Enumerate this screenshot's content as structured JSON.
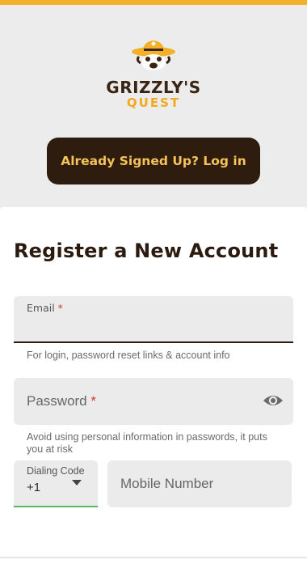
{
  "brand": {
    "name_line1": "GRIZZLY'S",
    "name_line2": "QUEST",
    "colors": {
      "accent": "#f3b12a",
      "dark": "#2e1d0e",
      "button_text": "#f6c35a"
    }
  },
  "hero": {
    "login_button_label": "Already Signed Up? Log in"
  },
  "form": {
    "title": "Register a New Account",
    "email": {
      "label": "Email",
      "required_mark": "*",
      "value": "",
      "helper": "For login, password reset links & account info"
    },
    "password": {
      "label": "Password",
      "required_mark": "*",
      "value": "",
      "helper": "Avoid using personal information in passwords, it puts you at risk",
      "toggle_icon": "eye-icon"
    },
    "dialing_code": {
      "label": "Dialing Code",
      "value": "+1",
      "icon": "caret-down-icon"
    },
    "mobile": {
      "placeholder": "Mobile Number",
      "value": ""
    }
  }
}
